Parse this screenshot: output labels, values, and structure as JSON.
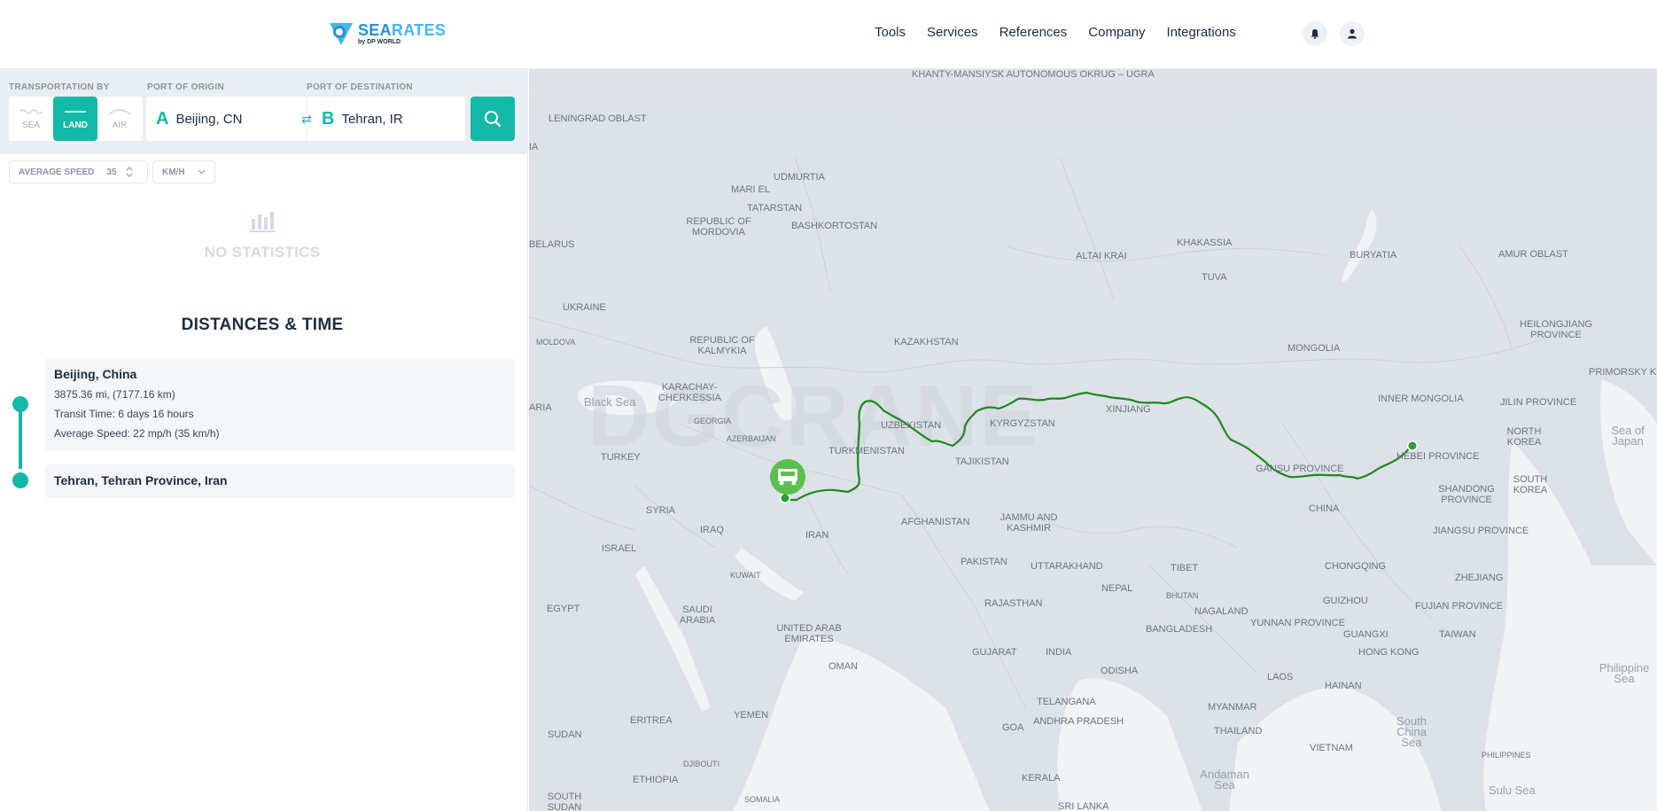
{
  "header": {
    "logo_main_a": "SEA",
    "logo_main_b": "RATES",
    "logo_sub": "by DP WORLD",
    "nav": [
      "Tools",
      "Services",
      "References",
      "Company",
      "Integrations"
    ]
  },
  "search": {
    "transport_label": "TRANSPORTATION BY",
    "origin_label": "PORT OF ORIGIN",
    "destination_label": "PORT OF DESTINATION",
    "modes": [
      {
        "label": "SEA",
        "active": false
      },
      {
        "label": "LAND",
        "active": true
      },
      {
        "label": "AIR",
        "active": false
      }
    ],
    "origin_letter": "A",
    "origin_value": "Beijing, CN",
    "destination_letter": "B",
    "destination_value": "Tehran, IR"
  },
  "speed": {
    "label": "AVERAGE SPEED",
    "value": "35",
    "unit": "KM/H"
  },
  "stats": {
    "empty_text": "NO STATISTICS"
  },
  "distances": {
    "title": "DISTANCES & TIME",
    "origin": {
      "name": "Beijing, China",
      "distance": "3875.36 mi, (7177.16 km)",
      "transit": "Transit Time: 6 days 16 hours",
      "speed": "Average Speed: 22 mp/h (35 km/h)"
    },
    "destination": {
      "name": "Tehran, Tehran Province, Iran"
    }
  },
  "map": {
    "watermark": "DGCRANE",
    "route_color": "#1a8a1a",
    "labels": [
      "KHANTY-MANSIYSK AUTONOMOUS OKRUG – UGRA",
      "LENINGRAD OBLAST",
      "UDMURTIA",
      "MARI EL",
      "TATARSTAN",
      "REPUBLIC OF MORDOVIA",
      "BASHKORTOSTAN",
      "BELARUS",
      "ALTAI KRAI",
      "KHAKASSIA",
      "BURYATIA",
      "AMUR OBLAST",
      "TUVA",
      "UKRAINE",
      "MOLDOVA",
      "REPUBLIC OF KALMYKIA",
      "KAZAKHSTAN",
      "MONGOLIA",
      "HEILONGJIANG PROVINCE",
      "PRIMORSKY KRA",
      "KARACHAY-CHERKESSIA",
      "Black Sea",
      "GEORGIA",
      "AZERBAIJAN",
      "UZBEKISTAN",
      "KYRGYZSTAN",
      "XINJIANG",
      "INNER MONGOLIA",
      "JILIN PROVINCE",
      "NORTH KOREA",
      "Sea of Japan",
      "TURKEY",
      "TURKMENISTAN",
      "TAJIKISTAN",
      "GANSU PROVINCE",
      "HEBEI PROVINCE",
      "SOUTH KOREA",
      "SHANDONG PROVINCE",
      "SYRIA",
      "IRAQ",
      "IRAN",
      "AFGHANISTAN",
      "JAMMU AND KASHMIR",
      "CHINA",
      "JIANGSU PROVINCE",
      "ISRAEL",
      "PAKISTAN",
      "UTTARAKHAND",
      "TIBET",
      "CHONGQING",
      "ZHEJIANG",
      "KUWAIT",
      "EGYPT",
      "SAUDI ARABIA",
      "NEPAL",
      "BHUTAN",
      "GUIZHOU",
      "RAJASTHAN",
      "NAGALAND",
      "FUJIAN PROVINCE",
      "UNITED ARAB EMIRATES",
      "BANGLADESH",
      "YUNNAN PROVINCE",
      "GUANGXI",
      "TAIWAN",
      "OMAN",
      "GUJARAT",
      "INDIA",
      "HONG KONG",
      "ODISHA",
      "LAOS",
      "Philippine Sea",
      "SUDAN",
      "HAINAN",
      "TELANGANA",
      "MYANMAR",
      "ERITREA",
      "YEMEN",
      "ANDHRA PRADESH",
      "GOA",
      "South China Sea",
      "THAILAND",
      "VIETNAM",
      "DJIBOUTI",
      "PHILIPPINES",
      "ETHIOPIA",
      "KERALA",
      "Andaman Sea",
      "Sulu Sea",
      "SOUTH SUDAN",
      "SOMALIA",
      "SRI LANKA",
      "ARIA",
      "IA"
    ]
  }
}
